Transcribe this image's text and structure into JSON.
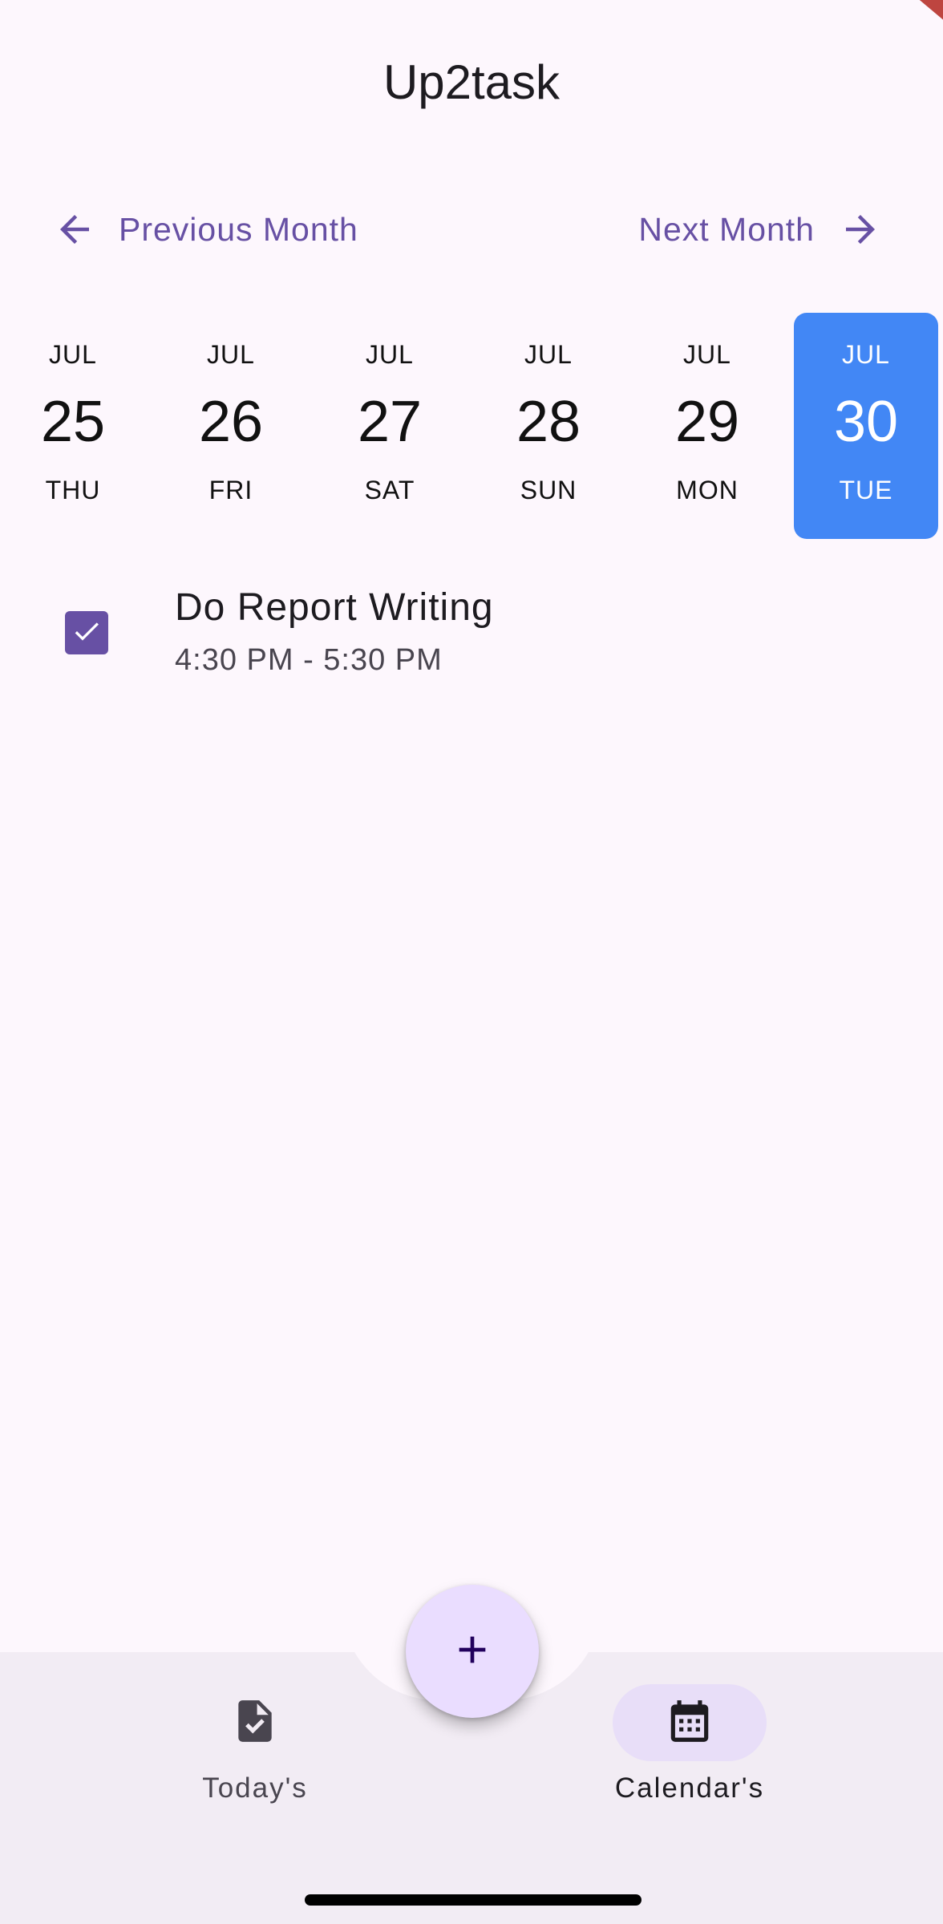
{
  "app": {
    "title": "Up2task"
  },
  "month_nav": {
    "previous_label": "Previous Month",
    "next_label": "Next Month"
  },
  "days": [
    {
      "month": "JUL",
      "date": "25",
      "weekday": "THU",
      "selected": false
    },
    {
      "month": "JUL",
      "date": "26",
      "weekday": "FRI",
      "selected": false
    },
    {
      "month": "JUL",
      "date": "27",
      "weekday": "SAT",
      "selected": false
    },
    {
      "month": "JUL",
      "date": "28",
      "weekday": "SUN",
      "selected": false
    },
    {
      "month": "JUL",
      "date": "29",
      "weekday": "MON",
      "selected": false
    },
    {
      "month": "JUL",
      "date": "30",
      "weekday": "TUE",
      "selected": true
    }
  ],
  "tasks": [
    {
      "title": "Do Report Writing",
      "time": "4:30 PM - 5:30 PM",
      "completed": true
    }
  ],
  "fab": {
    "icon": "plus-icon"
  },
  "bottom_nav": {
    "items": [
      {
        "label": "Today's",
        "icon": "task-document-icon",
        "active": false
      },
      {
        "label": "Calendar's",
        "icon": "calendar-icon",
        "active": true
      }
    ]
  },
  "colors": {
    "primary": "#6750a4",
    "selected_day": "#4287f5",
    "background": "#fdf7fd",
    "nav_bar": "#f2ecf4",
    "fab": "#eaddff"
  }
}
